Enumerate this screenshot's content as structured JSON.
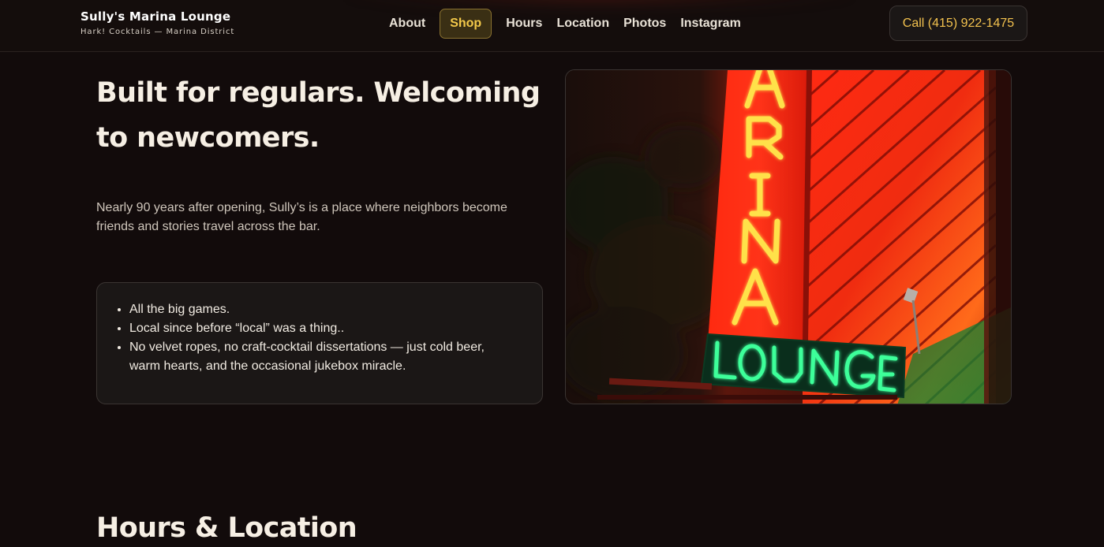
{
  "brand": {
    "title": "Sully's Marina Lounge",
    "subtitle": "Hark! Cocktails — Marina District"
  },
  "nav": {
    "items": [
      {
        "label": "About",
        "active": false
      },
      {
        "label": "Shop",
        "active": true
      },
      {
        "label": "Hours",
        "active": false
      },
      {
        "label": "Location",
        "active": false
      },
      {
        "label": "Photos",
        "active": false
      },
      {
        "label": "Instagram",
        "active": false
      }
    ]
  },
  "call_button": {
    "label": "Call (415) 922-1475"
  },
  "hero": {
    "title": "Built for regulars. Welcoming to newcomers.",
    "lead": "Nearly 90 years after opening, Sully’s is a place where neighbors become friends and stories travel across the bar.",
    "features": [
      "All the big games.",
      "Local since before “local” was a thing..",
      "No velvet ropes, no craft-cocktail dissertations — just cold beer, warm hearts, and the occasional jukebox miracle."
    ]
  },
  "photo": {
    "sign_letters": [
      "A",
      "R",
      "I",
      "N",
      "A"
    ],
    "sign_word": "LOUNGE"
  },
  "hours_section": {
    "title": "Hours & Location"
  },
  "colors": {
    "background": "#120b0b",
    "accent": "#f2c14e",
    "neon_red": "#e81e10",
    "neon_yellow": "#ffe14a",
    "neon_green": "#3dff9a"
  }
}
